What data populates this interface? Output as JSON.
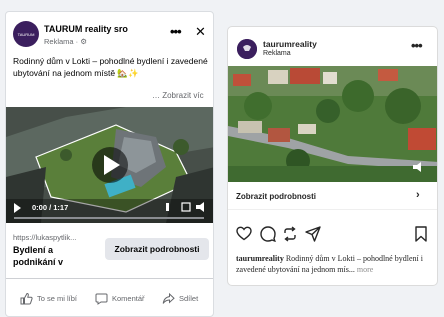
{
  "facebook": {
    "avatar_text": "TAURUM",
    "page_name": "TAURUM reality sro",
    "sponsored": "Reklama · ⚙",
    "post_text": "Rodinný dům v Lokti – pohodlné bydlení i zavedené ubytování na jednom místě 🏡✨",
    "see_more": "… Zobrazit víc",
    "video_time": "0:00 / 1:17",
    "link_url": "https://lukaspytlik...",
    "link_title": "Bydlení a podnikání v",
    "cta_label": "Zobrazit podrobnosti",
    "actions": {
      "like": "To se mi líbí",
      "comment": "Komentář",
      "share": "Sdílet"
    }
  },
  "instagram": {
    "username": "taurumreality",
    "sponsored": "Reklama",
    "link_label": "Zobrazit podrobnosti",
    "caption_user": "taurumreality",
    "caption_text": " Rodinný dům v Lokti – pohodlné bydlení i zavedené ubytování na jednom mís...",
    "caption_more": " more"
  },
  "colors": {
    "brand": "#3b1f5e",
    "fb_button": "#e4e6eb"
  }
}
